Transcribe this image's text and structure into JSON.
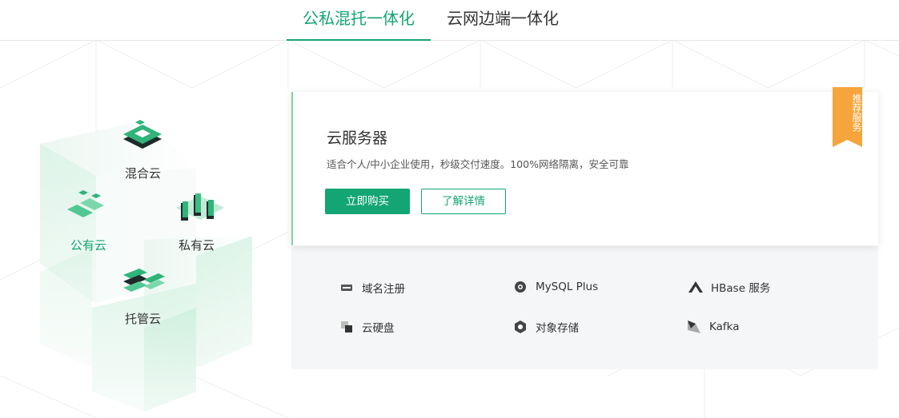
{
  "tabs": [
    {
      "label": "公私混托一体化",
      "active": true
    },
    {
      "label": "云网边端一体化",
      "active": false
    }
  ],
  "illustration": {
    "labels": {
      "hybrid": "混合云",
      "public": "公有云",
      "private": "私有云",
      "managed": "托管云"
    }
  },
  "card": {
    "title": "云服务器",
    "description": "适合个人/中小企业使用，秒级交付速度。100%网络隔离，安全可靠",
    "buy_label": "立即购买",
    "detail_label": "了解详情",
    "ribbon": "推荐服务"
  },
  "products": [
    {
      "label": "域名注册",
      "icon": "domain-icon"
    },
    {
      "label": "MySQL Plus",
      "icon": "mysql-icon"
    },
    {
      "label": "HBase 服务",
      "icon": "hbase-icon"
    },
    {
      "label": "云硬盘",
      "icon": "disk-icon"
    },
    {
      "label": "对象存储",
      "icon": "object-storage-icon"
    },
    {
      "label": "Kafka",
      "icon": "kafka-icon"
    }
  ],
  "colors": {
    "accent": "#13a574",
    "ribbon": "#f6a53d",
    "panel": "#f4f6f8"
  }
}
